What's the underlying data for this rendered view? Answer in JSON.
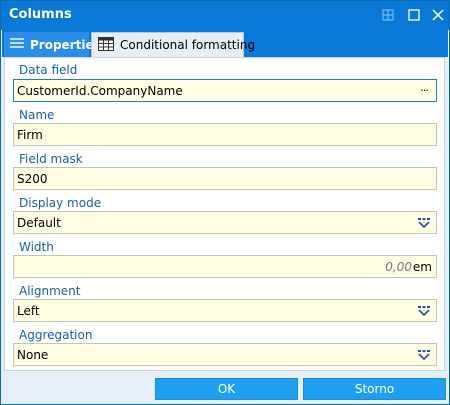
{
  "window": {
    "title": "Columns"
  },
  "tabs": [
    {
      "label": "Properties",
      "icon": "list-icon"
    },
    {
      "label": "Conditional formatting",
      "icon": "table-grid-icon"
    }
  ],
  "fields": {
    "data_field": {
      "label": "Data field",
      "value": "CustomerId.CompanyName",
      "button": "···"
    },
    "name": {
      "label": "Name",
      "value": "Firm"
    },
    "field_mask": {
      "label": "Field mask",
      "value": "S200"
    },
    "display_mode": {
      "label": "Display mode",
      "value": "Default"
    },
    "width": {
      "label": "Width",
      "value": "0,00",
      "unit": "em"
    },
    "alignment": {
      "label": "Alignment",
      "value": "Left"
    },
    "aggregation": {
      "label": "Aggregation",
      "value": "None"
    }
  },
  "buttons": {
    "ok": "OK",
    "storno": "Storno"
  },
  "colors": {
    "titlebar": "#0a78d7",
    "accent": "#1ea0f0",
    "field_bg": "#fffde2",
    "label": "#1a5fa4"
  }
}
